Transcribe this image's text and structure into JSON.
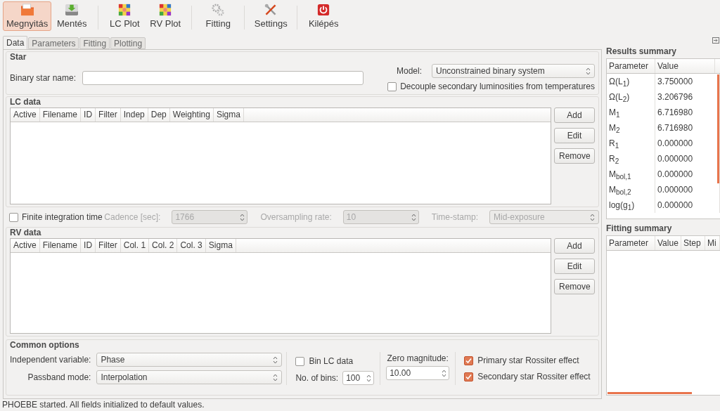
{
  "toolbar": {
    "groups": [
      [
        {
          "label": "Megnyitás",
          "kind": "open",
          "selected": true
        },
        {
          "label": "Mentés",
          "kind": "save",
          "selected": false
        }
      ],
      [
        {
          "label": "LC Plot",
          "kind": "plot",
          "selected": false
        },
        {
          "label": "RV Plot",
          "kind": "plot",
          "selected": false
        }
      ],
      [
        {
          "label": "Fitting",
          "kind": "gears",
          "selected": false
        }
      ],
      [
        {
          "label": "Settings",
          "kind": "tools",
          "selected": false
        }
      ],
      [
        {
          "label": "Kilépés",
          "kind": "power",
          "selected": false
        }
      ]
    ]
  },
  "tabs": [
    {
      "label": "Data",
      "selected": true
    },
    {
      "label": "Parameters",
      "selected": false
    },
    {
      "label": "Fitting",
      "selected": false
    },
    {
      "label": "Plotting",
      "selected": false
    }
  ],
  "star": {
    "title": "Star",
    "name_label": "Binary star name:",
    "model_label": "Model:",
    "model_value": "Unconstrained binary system",
    "decouple": {
      "label": "Decouple secondary luminosities from temperatures",
      "checked": false
    }
  },
  "lc_data": {
    "title": "LC data",
    "columns": [
      "Active",
      "Filename",
      "ID",
      "Filter",
      "Indep",
      "Dep",
      "Weighting",
      "Sigma"
    ],
    "buttons": [
      "Add",
      "Edit",
      "Remove"
    ]
  },
  "integration": {
    "finite": {
      "label": "Finite integration time",
      "checked": false
    },
    "fields": [
      {
        "kind": "spin",
        "label": "Cadence [sec]:",
        "value": "1766",
        "disabled": true
      },
      {
        "kind": "spin",
        "label": "Oversampling rate:",
        "value": "10",
        "disabled": true
      },
      {
        "kind": "combo",
        "label": "Time-stamp:",
        "value": "Mid-exposure",
        "disabled": true
      }
    ]
  },
  "rv_data": {
    "title": "RV data",
    "columns": [
      "Active",
      "Filename",
      "ID",
      "Filter",
      "Col. 1",
      "Col. 2",
      "Col. 3",
      "Sigma"
    ],
    "buttons": [
      "Add",
      "Edit",
      "Remove"
    ]
  },
  "common_options": {
    "title": "Common options",
    "independent": {
      "label": "Independent variable:",
      "value": "Phase"
    },
    "passband": {
      "label": "Passband mode:",
      "value": "Interpolation"
    },
    "bin": {
      "label": "Bin LC data",
      "checked": false
    },
    "bins": {
      "label": "No. of bins:",
      "value": "100"
    },
    "zero": {
      "label": "Zero magnitude:",
      "value": "10.00"
    },
    "rossiter": [
      {
        "label": "Primary star Rossiter effect",
        "checked": true
      },
      {
        "label": "Secondary star Rossiter effect",
        "checked": true
      }
    ]
  },
  "results_summary": {
    "title": "Results summary",
    "columns": [
      "Parameter",
      "Value"
    ],
    "rows": [
      {
        "parameter": "Ω(L$_{1}$)",
        "value": "3.750000"
      },
      {
        "parameter": "Ω(L$_{2}$)",
        "value": "3.206796"
      },
      {
        "parameter": "M$_{1}$",
        "value": "6.716980"
      },
      {
        "parameter": "M$_{2}$",
        "value": "6.716980"
      },
      {
        "parameter": "R$_{1}$",
        "value": "0.000000"
      },
      {
        "parameter": "R$_{2}$",
        "value": "0.000000"
      },
      {
        "parameter": "M$_{bol,1}$",
        "value": "0.000000"
      },
      {
        "parameter": "M$_{bol,2}$",
        "value": "0.000000"
      },
      {
        "parameter": "log(g$_{1}$)",
        "value": "0.000000"
      }
    ]
  },
  "fitting_summary": {
    "title": "Fitting summary",
    "columns": [
      "Parameter",
      "Value",
      "Step",
      "Mi"
    ]
  },
  "status_bar": "PHOEBE started. All fields initialized to default values."
}
